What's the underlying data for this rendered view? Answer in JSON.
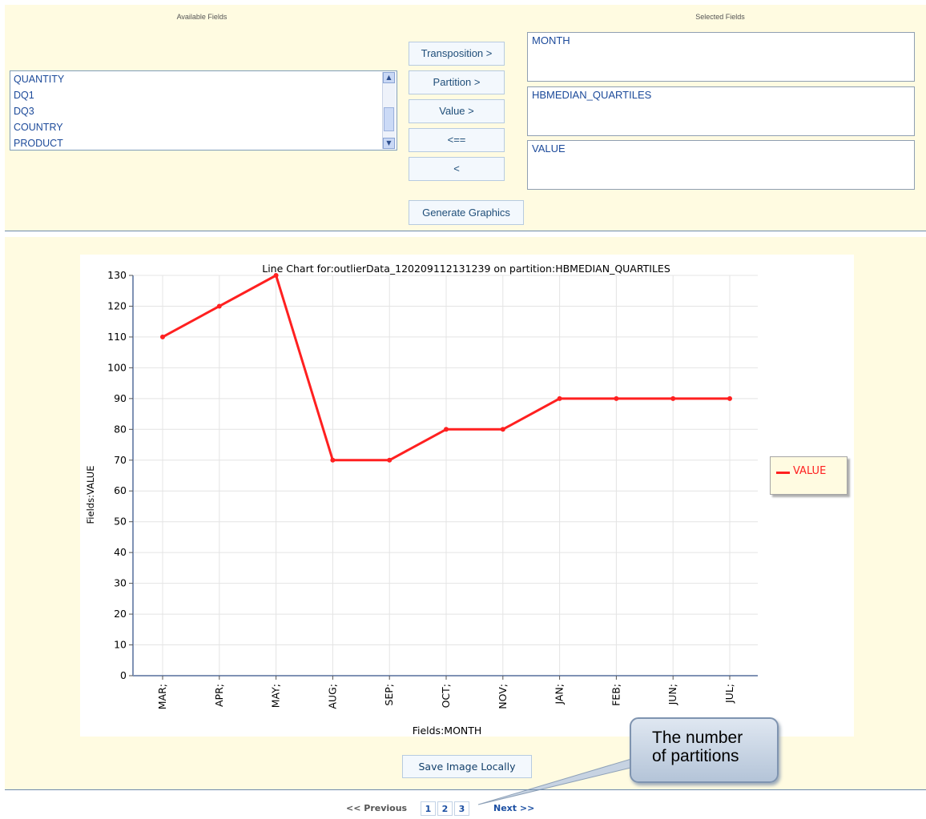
{
  "top_panel": {
    "available_header": "Available Fields",
    "selected_header": "Selected Fields",
    "available_fields": [
      "QUANTITY",
      "DQ1",
      "DQ3",
      "COUNTRY",
      "PRODUCT"
    ],
    "buttons": {
      "transposition": "Transposition >",
      "partition": "Partition >",
      "value": "Value >",
      "remove_all": "<==",
      "remove": "<",
      "generate": "Generate Graphics"
    },
    "selected": {
      "transposition": "MONTH",
      "partition": "HBMEDIAN_QUARTILES",
      "value": "VALUE"
    }
  },
  "chart_data": {
    "type": "line",
    "title": "Line Chart for:outlierData_120209112131239 on partition:HBMEDIAN_QUARTILES",
    "xlabel": "Fields:MONTH",
    "ylabel": "Fields:VALUE",
    "categories": [
      "MAR;",
      "APR;",
      "MAY;",
      "AUG;",
      "SEP;",
      "OCT;",
      "NOV;",
      "JAN;",
      "FEB;",
      "JUN;",
      "JUL;"
    ],
    "series": [
      {
        "name": "VALUE",
        "values": [
          110,
          120,
          130,
          70,
          70,
          80,
          80,
          90,
          90,
          90,
          90
        ],
        "color": "#ff2020"
      }
    ],
    "ylim": [
      0,
      130
    ],
    "yticks": [
      0,
      10,
      20,
      30,
      40,
      50,
      60,
      70,
      80,
      90,
      100,
      110,
      120,
      130
    ],
    "grid": true,
    "legend_position": "right"
  },
  "actions": {
    "save_label": "Save Image Locally"
  },
  "callout": {
    "line1": "The number",
    "line2": "of partitions"
  },
  "pager": {
    "previous": "<< Previous",
    "pages": [
      "1",
      "2",
      "3"
    ],
    "next": "Next >>"
  }
}
